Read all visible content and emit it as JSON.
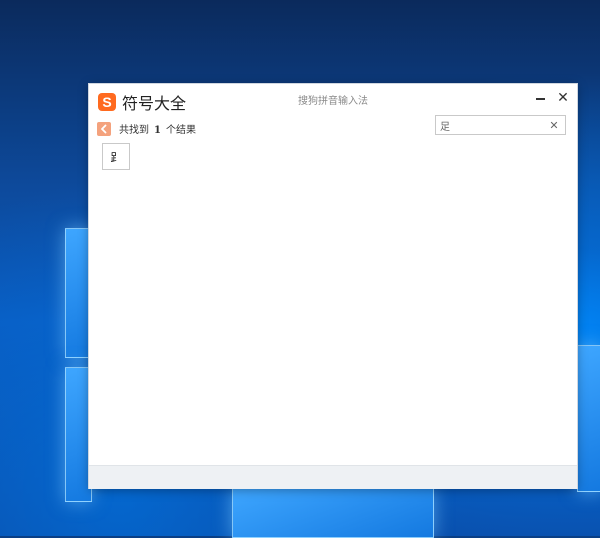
{
  "window": {
    "app_title": "符号大全",
    "logo_letter": "S",
    "subtitle": "搜狗拼音输入法",
    "minimize_icon": "minimize-icon",
    "close_glyph": "✕"
  },
  "results": {
    "prefix": "共找到",
    "count": "1",
    "suffix": "个结果"
  },
  "search": {
    "value": "足",
    "placeholder": "",
    "clear_glyph": "✕"
  },
  "symbols": [
    "⻊"
  ],
  "colors": {
    "logo_accent": "#ff6a1f",
    "back_button": "#f4a27d"
  }
}
